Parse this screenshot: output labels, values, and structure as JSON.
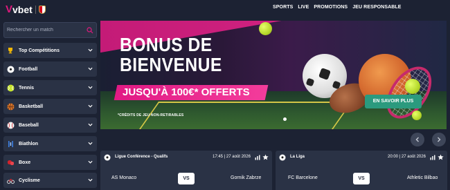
{
  "header": {
    "brand": "vbet",
    "nav": [
      "SPORTS",
      "LIVE",
      "PROMOTIONS",
      "JEU RESPONSABLE"
    ]
  },
  "sidebar": {
    "search_placeholder": "Rechercher un match",
    "items": [
      {
        "label": "Top Compétitions",
        "icon": "trophy-icon"
      },
      {
        "label": "Football",
        "icon": "soccer-ball-icon"
      },
      {
        "label": "Tennis",
        "icon": "tennis-ball-icon"
      },
      {
        "label": "Basketball",
        "icon": "basketball-icon"
      },
      {
        "label": "Baseball",
        "icon": "baseball-icon"
      },
      {
        "label": "Biathlon",
        "icon": "biathlon-icon"
      },
      {
        "label": "Boxe",
        "icon": "boxing-glove-icon"
      },
      {
        "label": "Cyclisme",
        "icon": "bicycle-icon"
      }
    ]
  },
  "banner": {
    "title_line1": "BONUS DE",
    "title_line2": "BIENVENUE",
    "offer": "JUSQU'À 100€* OFFERTS",
    "note": "*CRÉDITS DE JEU NON-RETIRABLES",
    "cta": "EN SAVOIR PLUS"
  },
  "matches": [
    {
      "league": "Ligue Conférence - Qualifs",
      "time": "17:45 | 27 août 2026",
      "home": "AS Monaco",
      "away": "Gornik Zabrze",
      "vs": "VS"
    },
    {
      "league": "La Liga",
      "time": "20:00 | 27 août 2026",
      "home": "FC Barcelone",
      "away": "Athletic Bilbao",
      "vs": "VS"
    }
  ],
  "colors": {
    "accent": "#e0197d",
    "cta": "#2b9a7e",
    "bg": "#1c2233",
    "panel": "#2a3245"
  }
}
